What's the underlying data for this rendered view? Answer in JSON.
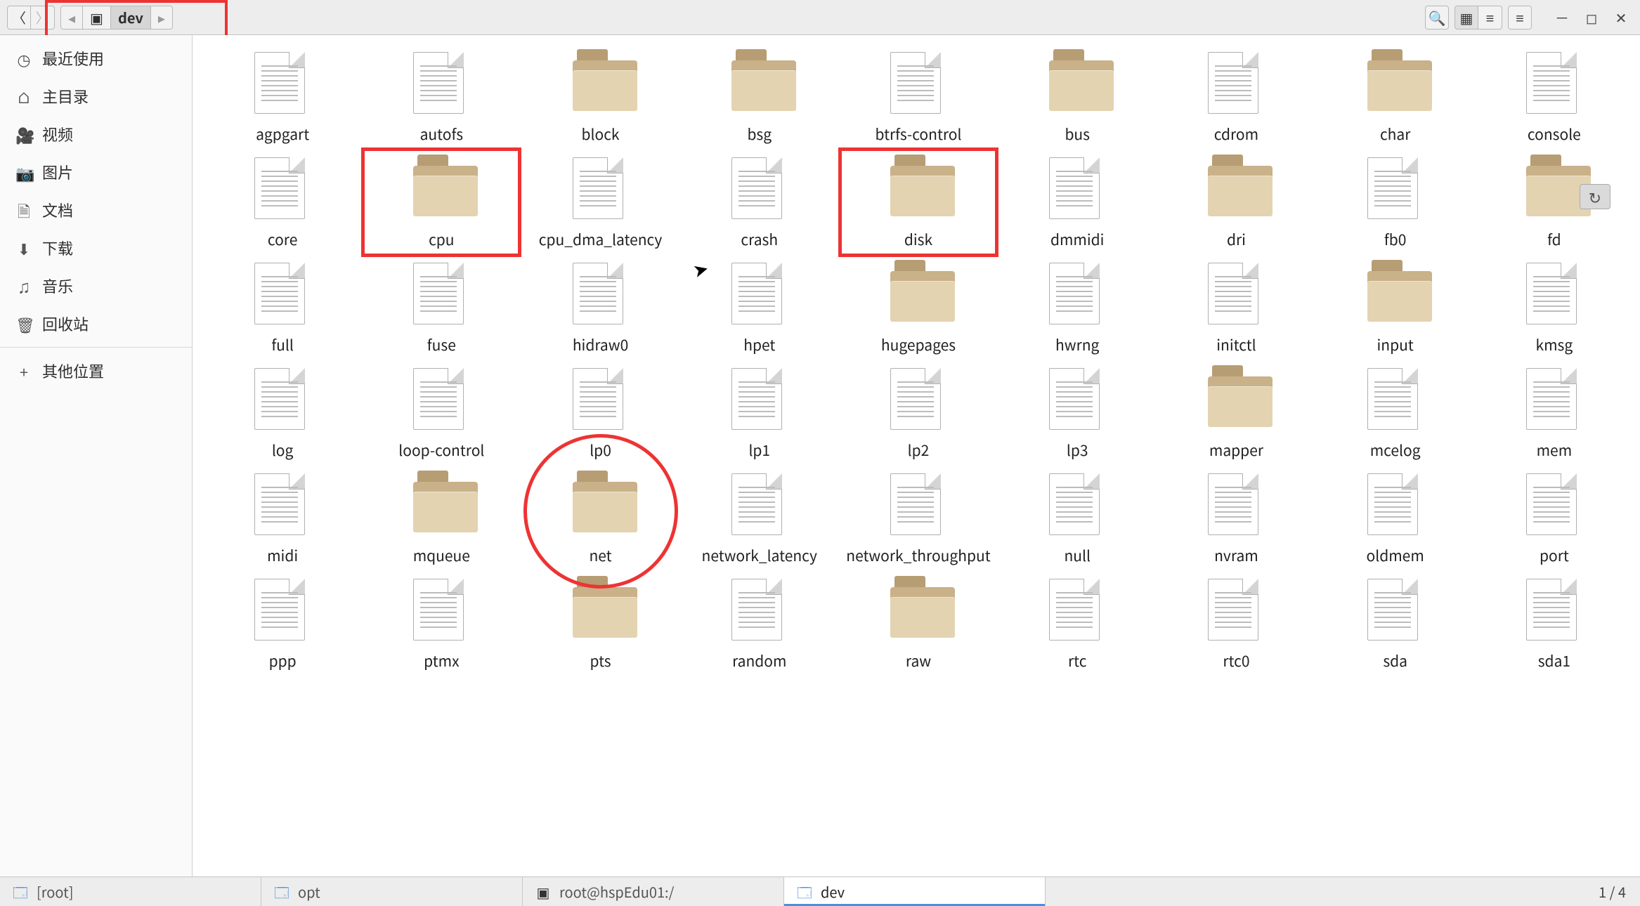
{
  "toolbar": {
    "breadcrumb_icon": "⌂",
    "breadcrumb_current": "dev"
  },
  "sidebar": {
    "items": [
      {
        "icon": "◷",
        "label": "最近使用"
      },
      {
        "icon": "⌂",
        "label": "主目录"
      },
      {
        "icon": "🎥",
        "label": "视频"
      },
      {
        "icon": "📷",
        "label": "图片"
      },
      {
        "icon": "🗎",
        "label": "文档"
      },
      {
        "icon": "⬇",
        "label": "下载"
      },
      {
        "icon": "♫",
        "label": "音乐"
      },
      {
        "icon": "🗑",
        "label": "回收站"
      }
    ],
    "other_label": "其他位置",
    "other_icon": "+"
  },
  "files": [
    {
      "name": "agpgart",
      "type": "file"
    },
    {
      "name": "autofs",
      "type": "file"
    },
    {
      "name": "block",
      "type": "folder"
    },
    {
      "name": "bsg",
      "type": "folder"
    },
    {
      "name": "btrfs-control",
      "type": "file"
    },
    {
      "name": "bus",
      "type": "folder"
    },
    {
      "name": "cdrom",
      "type": "file"
    },
    {
      "name": "char",
      "type": "folder"
    },
    {
      "name": "console",
      "type": "file"
    },
    {
      "name": "core",
      "type": "file"
    },
    {
      "name": "cpu",
      "type": "folder",
      "ann": "box"
    },
    {
      "name": "cpu_dma_latency",
      "type": "file"
    },
    {
      "name": "crash",
      "type": "file"
    },
    {
      "name": "disk",
      "type": "folder",
      "ann": "box"
    },
    {
      "name": "dmmidi",
      "type": "file"
    },
    {
      "name": "dri",
      "type": "folder"
    },
    {
      "name": "fb0",
      "type": "file"
    },
    {
      "name": "fd",
      "type": "folder",
      "shortcut": true
    },
    {
      "name": "full",
      "type": "file"
    },
    {
      "name": "fuse",
      "type": "file"
    },
    {
      "name": "hidraw0",
      "type": "file"
    },
    {
      "name": "hpet",
      "type": "file"
    },
    {
      "name": "hugepages",
      "type": "folder"
    },
    {
      "name": "hwrng",
      "type": "file"
    },
    {
      "name": "initctl",
      "type": "file"
    },
    {
      "name": "input",
      "type": "folder"
    },
    {
      "name": "kmsg",
      "type": "file"
    },
    {
      "name": "log",
      "type": "file"
    },
    {
      "name": "loop-control",
      "type": "file"
    },
    {
      "name": "lp0",
      "type": "file"
    },
    {
      "name": "lp1",
      "type": "file"
    },
    {
      "name": "lp2",
      "type": "file"
    },
    {
      "name": "lp3",
      "type": "file"
    },
    {
      "name": "mapper",
      "type": "folder"
    },
    {
      "name": "mcelog",
      "type": "file"
    },
    {
      "name": "mem",
      "type": "file"
    },
    {
      "name": "midi",
      "type": "file"
    },
    {
      "name": "mqueue",
      "type": "folder"
    },
    {
      "name": "net",
      "type": "folder",
      "ann": "circle"
    },
    {
      "name": "network_latency",
      "type": "file"
    },
    {
      "name": "network_throughput",
      "type": "file"
    },
    {
      "name": "null",
      "type": "file"
    },
    {
      "name": "nvram",
      "type": "file"
    },
    {
      "name": "oldmem",
      "type": "file"
    },
    {
      "name": "port",
      "type": "file"
    },
    {
      "name": "ppp",
      "type": "file"
    },
    {
      "name": "ptmx",
      "type": "file"
    },
    {
      "name": "pts",
      "type": "folder"
    },
    {
      "name": "random",
      "type": "file"
    },
    {
      "name": "raw",
      "type": "folder"
    },
    {
      "name": "rtc",
      "type": "file"
    },
    {
      "name": "rtc0",
      "type": "file"
    },
    {
      "name": "sda",
      "type": "file"
    },
    {
      "name": "sda1",
      "type": "file"
    }
  ],
  "taskbar": {
    "tasks": [
      {
        "icon": "🗔",
        "label": "[root]",
        "active": false,
        "color": "#4a90d9"
      },
      {
        "icon": "🗔",
        "label": "opt",
        "active": false,
        "color": "#4a90d9"
      },
      {
        "icon": "▣",
        "label": "root@hspEdu01:/",
        "active": false,
        "color": "#333"
      },
      {
        "icon": "🗔",
        "label": "dev",
        "active": true,
        "color": "#4a90d9"
      }
    ],
    "status": "1 / 4"
  }
}
